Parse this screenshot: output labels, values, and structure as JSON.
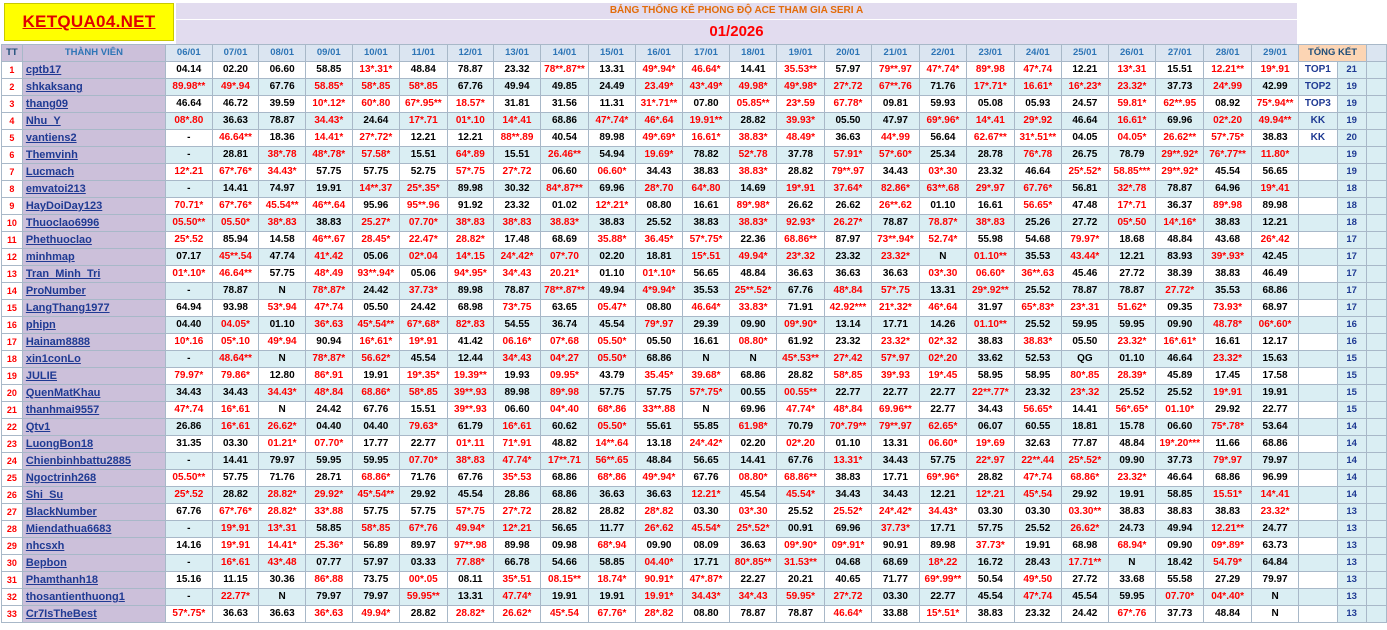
{
  "site_logo": "KETQUA04.NET",
  "board_title": "BẢNG THỐNG KÊ PHONG ĐỘ ACE THAM GIA SERI A",
  "month": "01/2026",
  "headers": {
    "tt": "TT",
    "member": "THÀNH VIÊN",
    "dates": [
      "06/01",
      "07/01",
      "08/01",
      "09/01",
      "10/01",
      "11/01",
      "12/01",
      "13/01",
      "14/01",
      "15/01",
      "16/01",
      "17/01",
      "18/01",
      "19/01",
      "20/01",
      "21/01",
      "22/01",
      "23/01",
      "24/01",
      "25/01",
      "26/01",
      "27/01",
      "28/01",
      "29/01"
    ],
    "summary": "TỔNG KẾT"
  },
  "colors": {
    "logo_bg": "#ffff00",
    "logo_text": "#e00000",
    "title_text": "#e36c0a",
    "month_text": "#ff0000",
    "name_bg": "#ccc0da",
    "row_alt_bg": "#daeef3",
    "value_black": "#000000",
    "value_red": "#ff0000",
    "header_text": "#2e75b6"
  },
  "rows": [
    {
      "tt": "1",
      "name": "cptb17",
      "values": [
        "04.14",
        "02.20",
        "06.60",
        "58.85",
        "13*.31*",
        "48.84",
        "78.87",
        "23.32",
        "78**.87**",
        "13.31",
        "49*.94*",
        "46.64*",
        "14.41",
        "35.53**",
        "57.97",
        "79**.97",
        "47*.74*",
        "89*.98",
        "47*.74",
        "12.21",
        "13*.31",
        "15.51",
        "12.21**",
        "19*.91"
      ],
      "rank": "TOP1",
      "total": "21"
    },
    {
      "tt": "2",
      "name": "shkaksang",
      "values": [
        "89.98**",
        "49*.94",
        "67.76",
        "58.85*",
        "58*.85",
        "58*.85",
        "67.76",
        "49.94",
        "49.85",
        "24.49",
        "23.49*",
        "43*.49*",
        "49.98*",
        "49*.98*",
        "27*.72",
        "67**.76",
        "71.76",
        "17*.71*",
        "16.61*",
        "16*.23*",
        "23.32*",
        "37.73",
        "24*.99",
        "42.99"
      ],
      "rank": "TOP2",
      "total": "19"
    },
    {
      "tt": "3",
      "name": "thang09",
      "values": [
        "46.64",
        "46.72",
        "39.59",
        "10*.12*",
        "60*.80",
        "67*.95**",
        "18.57*",
        "31.81",
        "31.56",
        "11.31",
        "31*.71**",
        "07.80",
        "05.85**",
        "23*.59",
        "67.78*",
        "09.81",
        "59.93",
        "05.08",
        "05.93",
        "24.57",
        "59.81*",
        "62**.95",
        "08.92",
        "75*.94**"
      ],
      "rank": "TOP3",
      "total": "19"
    },
    {
      "tt": "4",
      "name": "Nhu_Y",
      "values": [
        "08*.80",
        "36.63",
        "78.87",
        "34.43*",
        "24.64",
        "17*.71",
        "01*.10",
        "14*.41",
        "68.86",
        "47*.74*",
        "46*.64",
        "19.91**",
        "28.82",
        "39.93*",
        "05.50",
        "47.97",
        "69*.96*",
        "14*.41",
        "29*.92",
        "46.64",
        "16.61*",
        "69.96",
        "02*.20",
        "49.94**"
      ],
      "rank": "KK",
      "total": "19"
    },
    {
      "tt": "5",
      "name": "vantiens2",
      "values": [
        "-",
        "46.64**",
        "18.36",
        "14.41*",
        "27*.72*",
        "12.21",
        "12.21",
        "88**.89",
        "40.54",
        "89.98",
        "49*.69*",
        "16.61*",
        "38.83*",
        "48.49*",
        "36.63",
        "44*.99",
        "56.64",
        "62.67**",
        "31*.51**",
        "04.05",
        "04.05*",
        "26.62**",
        "57*.75*",
        "38.83"
      ],
      "rank": "KK",
      "total": "20"
    },
    {
      "tt": "6",
      "name": "Themvinh",
      "values": [
        "-",
        "28.81",
        "38*.78",
        "48*.78*",
        "57.58*",
        "15.51",
        "64*.89",
        "15.51",
        "26.46**",
        "54.94",
        "19.69*",
        "78.82",
        "52*.78",
        "37.78",
        "57.91*",
        "57*.60*",
        "25.34",
        "28.78",
        "76*.78",
        "26.75",
        "78.79",
        "29**.92*",
        "76*.77**",
        "11.80*"
      ],
      "rank": "",
      "total": "19"
    },
    {
      "tt": "7",
      "name": "Lucmach",
      "values": [
        "12*.21",
        "67*.76*",
        "34.43*",
        "57.75",
        "57.75",
        "52.75",
        "57*.75",
        "27*.72",
        "06.60",
        "06.60*",
        "34.43",
        "38.83",
        "38.83*",
        "28.82",
        "79**.97",
        "34.43",
        "03*.30",
        "23.32",
        "46.64",
        "25*.52*",
        "58.85***",
        "29**.92*",
        "45.54",
        "56.65"
      ],
      "rank": "",
      "total": "19"
    },
    {
      "tt": "8",
      "name": "emvatoi213",
      "values": [
        "-",
        "14.41",
        "74.97",
        "19.91",
        "14**.37",
        "25*.35*",
        "89.98",
        "30.32",
        "84*.87**",
        "69.96",
        "28*.70",
        "64*.80",
        "14.69",
        "19*.91",
        "37.64*",
        "82.86*",
        "63**.68",
        "29*.97",
        "67.76*",
        "56.81",
        "32*.78",
        "78.87",
        "64.96",
        "19*.41"
      ],
      "rank": "",
      "total": "18"
    },
    {
      "tt": "9",
      "name": "HayDoiDay123",
      "values": [
        "70.71*",
        "67*.76*",
        "45.54**",
        "46**.64",
        "95.96",
        "95**.96",
        "91.92",
        "23.32",
        "01.02",
        "12*.21*",
        "08.80",
        "16.61",
        "89*.98*",
        "26.62",
        "26.62",
        "26**.62",
        "01.10",
        "16.61",
        "56.65*",
        "47.48",
        "17*.71",
        "36.37",
        "89*.98",
        "89.98"
      ],
      "rank": "",
      "total": "18"
    },
    {
      "tt": "10",
      "name": "Thuoclao6996",
      "values": [
        "05.50**",
        "05.50*",
        "38*.83",
        "38.83",
        "25.27*",
        "07.70*",
        "38*.83",
        "38*.83",
        "38.83*",
        "38.83",
        "25.52",
        "38.83",
        "38.83*",
        "92.93*",
        "26.27*",
        "78.87",
        "78.87*",
        "38*.83",
        "25.26",
        "27.72",
        "05*.50",
        "14*.16*",
        "38.83",
        "12.21"
      ],
      "rank": "",
      "total": "18"
    },
    {
      "tt": "11",
      "name": "Phethuoclao",
      "values": [
        "25*.52",
        "85.94",
        "14.58",
        "46**.67",
        "28.45*",
        "22.47*",
        "28.82*",
        "17.48",
        "68.69",
        "35.88*",
        "36.45*",
        "57*.75*",
        "22.36",
        "68.86**",
        "87.97",
        "73**.94*",
        "52.74*",
        "55.98",
        "54.68",
        "79.97*",
        "18.68",
        "48.84",
        "43.68",
        "26*.42"
      ],
      "rank": "",
      "total": "17"
    },
    {
      "tt": "12",
      "name": "minhmap",
      "values": [
        "07.17",
        "45**.54",
        "47.74",
        "41*.42",
        "05.06",
        "02*.04",
        "14*.15",
        "24*.42*",
        "07*.70",
        "02.20",
        "18.81",
        "15*.51",
        "49.94*",
        "23*.32",
        "23.32",
        "23.32*",
        "N",
        "01.10**",
        "35.53",
        "43.44*",
        "12.21",
        "83.93",
        "39*.93*",
        "42.45"
      ],
      "rank": "",
      "total": "17"
    },
    {
      "tt": "13",
      "name": "Tran_Minh_Tri",
      "values": [
        "01*.10*",
        "46.64**",
        "57.75",
        "48*.49",
        "93**.94*",
        "05.06",
        "94*.95*",
        "34*.43",
        "20.21*",
        "01.10",
        "01*.10*",
        "56.65",
        "48.84",
        "36.63",
        "36.63",
        "36.63",
        "03*.30",
        "06.60*",
        "36**.63",
        "45.46",
        "27.72",
        "38.39",
        "38.83",
        "46.49"
      ],
      "rank": "",
      "total": "17"
    },
    {
      "tt": "14",
      "name": "ProNumber",
      "values": [
        "-",
        "78.87",
        "N",
        "78*.87*",
        "24.42",
        "37.73*",
        "89.98",
        "78.87",
        "78**.87**",
        "49.94",
        "4*9.94*",
        "35.53",
        "25**.52*",
        "67.76",
        "48*.84",
        "57*.75",
        "13.31",
        "29*.92**",
        "25.52",
        "78.87",
        "78.87",
        "27.72*",
        "35.53",
        "68.86"
      ],
      "rank": "",
      "total": "17"
    },
    {
      "tt": "15",
      "name": "LangThang1977",
      "values": [
        "64.94",
        "93.98",
        "53*.94",
        "47*.74",
        "05.50",
        "24.42",
        "68.98",
        "73*.75",
        "63.65",
        "05.47*",
        "08.80",
        "46.64*",
        "33.83*",
        "71.91",
        "42.92***",
        "21*.32*",
        "46*.64",
        "31.97",
        "65*.83*",
        "23*.31",
        "51.62*",
        "09.35",
        "73.93*",
        "68.97"
      ],
      "rank": "",
      "total": "17"
    },
    {
      "tt": "16",
      "name": "phipn",
      "values": [
        "04.40",
        "04.05*",
        "01.10",
        "36*.63",
        "45*.54**",
        "67*.68*",
        "82*.83",
        "54.55",
        "36.74",
        "45.54",
        "79*.97",
        "29.39",
        "09.90",
        "09*.90*",
        "13.14",
        "17.71",
        "14.26",
        "01.10**",
        "25.52",
        "59.95",
        "59.95",
        "09.90",
        "48.78*",
        "06*.60*"
      ],
      "rank": "",
      "total": "16"
    },
    {
      "tt": "17",
      "name": "Hainam8888",
      "values": [
        "10*.16",
        "05*.10",
        "49*.94",
        "90.94",
        "16*.61*",
        "19*.91",
        "41.42",
        "06.16*",
        "07*.68",
        "05.50*",
        "05.50",
        "16.61",
        "08.80*",
        "61.92",
        "23.32",
        "23.32*",
        "02*.32",
        "38.83",
        "38.83*",
        "05.50",
        "23.32*",
        "16*.61*",
        "16.61",
        "12.17"
      ],
      "rank": "",
      "total": "16"
    },
    {
      "tt": "18",
      "name": "xin1conLo",
      "values": [
        "-",
        "48.64**",
        "N",
        "78*.87*",
        "56.62*",
        "45.54",
        "12.44",
        "34*.43",
        "04*.27",
        "05.50*",
        "68.86",
        "N",
        "N",
        "45*.53**",
        "27*.42",
        "57*.97",
        "02*.20",
        "33.62",
        "52.53",
        "QG",
        "01.10",
        "46.64",
        "23.32*",
        "15.63"
      ],
      "rank": "",
      "total": "15"
    },
    {
      "tt": "19",
      "name": "JULIE",
      "values": [
        "79.97*",
        "79.86*",
        "12.80",
        "86*.91",
        "19.91",
        "19*.35*",
        "19.39**",
        "19.93",
        "09.95*",
        "43.79",
        "35.45*",
        "39.68*",
        "68.86",
        "28.82",
        "58*.85",
        "39*.93",
        "19*.45",
        "58.95",
        "58.95",
        "80*.85",
        "28.39*",
        "45.89",
        "17.45",
        "17.58"
      ],
      "rank": "",
      "total": "15"
    },
    {
      "tt": "20",
      "name": "QuenMatKhau",
      "values": [
        "34.43",
        "34.43",
        "34.43*",
        "48*.84",
        "68.86*",
        "58*.85",
        "39**.93",
        "89.98",
        "89*.98",
        "57.75",
        "57.75",
        "57*.75*",
        "00.55",
        "00.55**",
        "22.77",
        "22.77",
        "22.77",
        "22**.77*",
        "23.32",
        "23*.32",
        "25.52",
        "25.52",
        "19*.91",
        "19.91"
      ],
      "rank": "",
      "total": "15"
    },
    {
      "tt": "21",
      "name": "thanhmai9557",
      "values": [
        "47*.74",
        "16*.61",
        "N",
        "24.42",
        "67.76",
        "15.51",
        "39**.93",
        "06.60",
        "04*.40",
        "68*.86",
        "33**.88",
        "N",
        "69.96",
        "47.74*",
        "48*.84",
        "69.96**",
        "22.77",
        "34.43",
        "56.65*",
        "14.41",
        "56*.65*",
        "01.10*",
        "29.92",
        "22.77"
      ],
      "rank": "",
      "total": "15"
    },
    {
      "tt": "22",
      "name": "Qtv1",
      "values": [
        "26.86",
        "16*.61",
        "26.62*",
        "04.40",
        "04.40",
        "79.63*",
        "61.79",
        "16*.61",
        "60.62",
        "05.50*",
        "55.61",
        "55.85",
        "61.98*",
        "70.79",
        "70*.79**",
        "79**.97",
        "62.65*",
        "06.07",
        "60.55",
        "18.81",
        "15.78",
        "06.60",
        "75*.78*",
        "53.64"
      ],
      "rank": "",
      "total": "14"
    },
    {
      "tt": "23",
      "name": "LuongBon18",
      "values": [
        "31.35",
        "03.30",
        "01.21*",
        "07.70*",
        "17.77",
        "22.77",
        "01*.11",
        "71*.91",
        "48.82",
        "14**.64",
        "13.18",
        "24*.42*",
        "02.20",
        "02*.20",
        "01.10",
        "13.31",
        "06.60*",
        "19*.69",
        "32.63",
        "77.87",
        "48.84",
        "19*.20***",
        "11.66",
        "68.86"
      ],
      "rank": "",
      "total": "14"
    },
    {
      "tt": "24",
      "name": "Chienbinhbattu2885",
      "values": [
        "-",
        "14.41",
        "79.97",
        "59.95",
        "59.95",
        "07.70*",
        "38*.83",
        "47.74*",
        "17**.71",
        "56**.65",
        "48.84",
        "56.65",
        "14.41",
        "67.76",
        "13.31*",
        "34.43",
        "57.75",
        "22*.97",
        "22**.44",
        "25*.52*",
        "09.90",
        "37.73",
        "79*.97",
        "79.97"
      ],
      "rank": "",
      "total": "14"
    },
    {
      "tt": "25",
      "name": "Ngoctrinh268",
      "values": [
        "05.50**",
        "57.75",
        "71.76",
        "28.71",
        "68.86*",
        "71.76",
        "67.76",
        "35*.53",
        "68.86",
        "68*.86",
        "49*.94*",
        "67.76",
        "08.80*",
        "68.86**",
        "38.83",
        "17.71",
        "69*.96*",
        "28.82",
        "47*.74",
        "68.86*",
        "23.32*",
        "46.64",
        "68.86",
        "96.99"
      ],
      "rank": "",
      "total": "14"
    },
    {
      "tt": "26",
      "name": "Shi_Su",
      "values": [
        "25*.52",
        "28.82",
        "28.82*",
        "29.92*",
        "45*.54**",
        "29.92",
        "45.54",
        "28.86",
        "68.86",
        "36.63",
        "36.63",
        "12.21*",
        "45.54",
        "45.54*",
        "34.43",
        "34.43",
        "12.21",
        "12*.21",
        "45*.54",
        "29.92",
        "19.91",
        "58.85",
        "15.51*",
        "14*.41"
      ],
      "rank": "",
      "total": "14"
    },
    {
      "tt": "27",
      "name": "BlackNumber",
      "values": [
        "67.76",
        "67*.76*",
        "28.82*",
        "33*.88",
        "57.75",
        "57.75",
        "57*.75",
        "27*.72",
        "28.82",
        "28.82",
        "28*.82",
        "03.30",
        "03*.30",
        "25.52",
        "25.52*",
        "24*.42*",
        "34.43*",
        "03.30",
        "03.30",
        "03.30**",
        "38.83",
        "38.83",
        "38.83",
        "23.32*"
      ],
      "rank": "",
      "total": "13"
    },
    {
      "tt": "28",
      "name": "Miendathua6683",
      "values": [
        "-",
        "19*.91",
        "13*.31",
        "58.85",
        "58*.85",
        "67*.76",
        "49.94*",
        "12*.21",
        "56.65",
        "11.77",
        "26*.62",
        "45.54*",
        "25*.52*",
        "00.91",
        "69.96",
        "37.73*",
        "17.71",
        "57.75",
        "25.52",
        "26.62*",
        "24.73",
        "49.94",
        "12.21**",
        "24.77"
      ],
      "rank": "",
      "total": "13"
    },
    {
      "tt": "29",
      "name": "nhcsxh",
      "values": [
        "14.16",
        "19*.91",
        "14.41*",
        "25.36*",
        "56.89",
        "89.97",
        "97**.98",
        "89.98",
        "09.98",
        "68*.94",
        "09.90",
        "08.09",
        "36.63",
        "09*.90*",
        "09*.91*",
        "90.91",
        "89.98",
        "37.73*",
        "19.91",
        "68.98",
        "68.94*",
        "09.90",
        "09*.89*",
        "63.73"
      ],
      "rank": "",
      "total": "13"
    },
    {
      "tt": "30",
      "name": "Bepbon",
      "values": [
        "-",
        "16*.61",
        "43*.48",
        "07.77",
        "57.97",
        "03.33",
        "77.88*",
        "66.78",
        "54.66",
        "58.85",
        "04.40*",
        "17.71",
        "80*.85**",
        "31.53**",
        "04.68",
        "68.69",
        "18*.22",
        "16.72",
        "28.43",
        "17.71**",
        "N",
        "18.42",
        "54.79*",
        "64.84"
      ],
      "rank": "",
      "total": "13"
    },
    {
      "tt": "31",
      "name": "Phamthanh18",
      "values": [
        "15.16",
        "11.15",
        "30.36",
        "86*.88",
        "73.75",
        "00*.05",
        "08.11",
        "35*.51",
        "08.15**",
        "18.74*",
        "90.91*",
        "47*.87*",
        "22.27",
        "20.21",
        "40.65",
        "71.77",
        "69*.99**",
        "50.54",
        "49*.50",
        "27.72",
        "33.68",
        "55.58",
        "27.29",
        "79.97"
      ],
      "rank": "",
      "total": "13"
    },
    {
      "tt": "32",
      "name": "thosantienthuong1",
      "values": [
        "-",
        "22.77*",
        "N",
        "79.97",
        "79.97",
        "59.95**",
        "13.31",
        "47.74*",
        "19.91",
        "19.91",
        "19.91*",
        "34.43*",
        "34*.43",
        "59.95*",
        "27*.72",
        "03.30",
        "22.77",
        "45.54",
        "47*.74",
        "45.54",
        "59.95",
        "07.70*",
        "04*.40*",
        "N"
      ],
      "rank": "",
      "total": "13"
    },
    {
      "tt": "33",
      "name": "Cr7IsTheBest",
      "values": [
        "57*.75*",
        "36.63",
        "36.63",
        "36*.63",
        "49.94*",
        "28.82",
        "28.82*",
        "26.62*",
        "45*.54",
        "67.76*",
        "28*.82",
        "08.80",
        "78.87",
        "78.87",
        "46.64*",
        "33.88",
        "15*.51*",
        "38.83",
        "23.32",
        "24.42",
        "67*.76",
        "37.73",
        "48.84",
        "N"
      ],
      "rank": "",
      "total": "13"
    }
  ]
}
